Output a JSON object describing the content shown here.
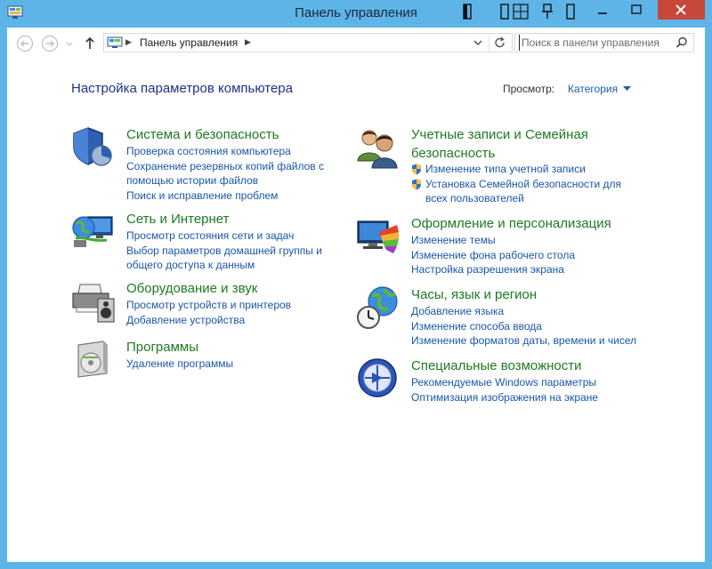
{
  "window": {
    "title": "Панель управления"
  },
  "address": {
    "path": "Панель управления"
  },
  "search": {
    "placeholder": "Поиск в панели управления"
  },
  "page": {
    "heading": "Настройка параметров компьютера",
    "view_by_label": "Просмотр:",
    "view_by_value": "Категория"
  },
  "categories": [
    {
      "title": "Система и безопасность",
      "links": [
        "Проверка состояния компьютера",
        "Сохранение резервных копий файлов с",
        "помощью истории файлов",
        "Поиск и исправление проблем"
      ]
    },
    {
      "title": "Сеть и Интернет",
      "links": [
        "Просмотр состояния сети и задач",
        "Выбор параметров домашней группы и",
        "общего доступа к данным"
      ]
    },
    {
      "title": "Оборудование и звук",
      "links": [
        "Просмотр устройств и принтеров",
        "Добавление устройства"
      ]
    },
    {
      "title": "Программы",
      "links": [
        "Удаление программы"
      ]
    },
    {
      "title_line1": "Учетные записи и Семейная",
      "title_line2": "безопасность",
      "links": [
        "Изменение типа учетной записи",
        "Установка Семейной безопасности для",
        "всех пользователей"
      ]
    },
    {
      "title": "Оформление и персонализация",
      "links": [
        "Изменение темы",
        "Изменение фона рабочего стола",
        "Настройка разрешения экрана"
      ]
    },
    {
      "title": "Часы, язык и регион",
      "links": [
        "Добавление языка",
        "Изменение способа ввода",
        "Изменение форматов даты, времени и чисел"
      ]
    },
    {
      "title": "Специальные возможности",
      "links": [
        "Рекомендуемые Windows параметры",
        "Оптимизация изображения на экране"
      ]
    }
  ]
}
